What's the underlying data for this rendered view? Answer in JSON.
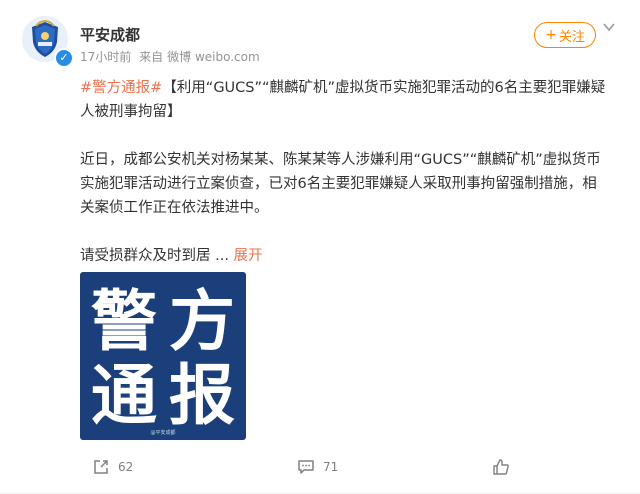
{
  "author": {
    "name": "平安成都",
    "verified": true,
    "avatar_icon": "police-badge-avatar"
  },
  "meta": {
    "time": "17小时前",
    "source_prefix": "来自",
    "source": "微博 weibo.com"
  },
  "follow_button": {
    "plus": "+",
    "label": "关注"
  },
  "post": {
    "hashtag": "#警方通报#",
    "title": "【利用“GUCS”“麒麟矿机”虚拟货币实施犯罪活动的6名主要犯罪嫌疑人被刑事拘留】",
    "paragraph": "近日，成都公安机关对杨某某、陈某某等人涉嫌利用“GUCS”“麒麟矿机”虚拟货币实施犯罪活动进行立案侦查，已对6名主要犯罪嫌疑人采取刑事拘留强制措施，相关案侦工作正在依法推进中。",
    "truncated_line": "请受损群众及时到居",
    "ellipsis": "...",
    "expand_label": "展开"
  },
  "image": {
    "chars": [
      "警",
      "方",
      "通",
      "报"
    ],
    "watermark": "@平安成都",
    "background_color": "#1a3f7a"
  },
  "actions": {
    "share_count": "62",
    "comment_count": "71"
  },
  "colors": {
    "accent": "#ff8200",
    "link": "#eb7350",
    "verified": "#2a8de5",
    "meta": "#939393"
  }
}
